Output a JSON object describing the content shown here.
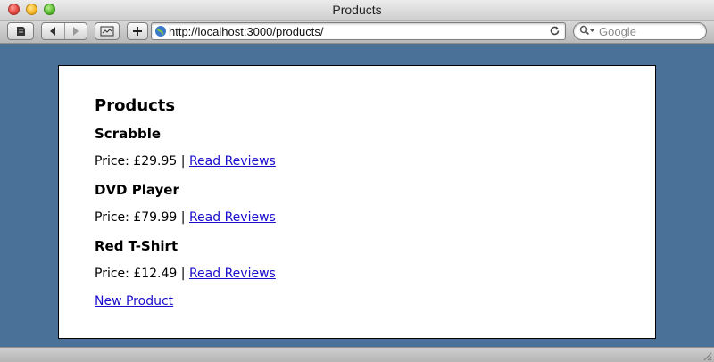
{
  "window": {
    "title": "Products"
  },
  "toolbar": {
    "address": "http://localhost:3000/products/",
    "search_placeholder": "Google"
  },
  "page": {
    "heading": "Products",
    "price_label": "Price:",
    "separator": "|",
    "review_link": "Read Reviews",
    "products": [
      {
        "name": "Scrabble",
        "price": "£29.95"
      },
      {
        "name": "DVD Player",
        "price": "£79.99"
      },
      {
        "name": "Red T-Shirt",
        "price": "£12.49"
      }
    ],
    "new_product_link": "New Product"
  },
  "colors": {
    "desktop_background": "#4a7298",
    "link": "#1a0dcc"
  }
}
